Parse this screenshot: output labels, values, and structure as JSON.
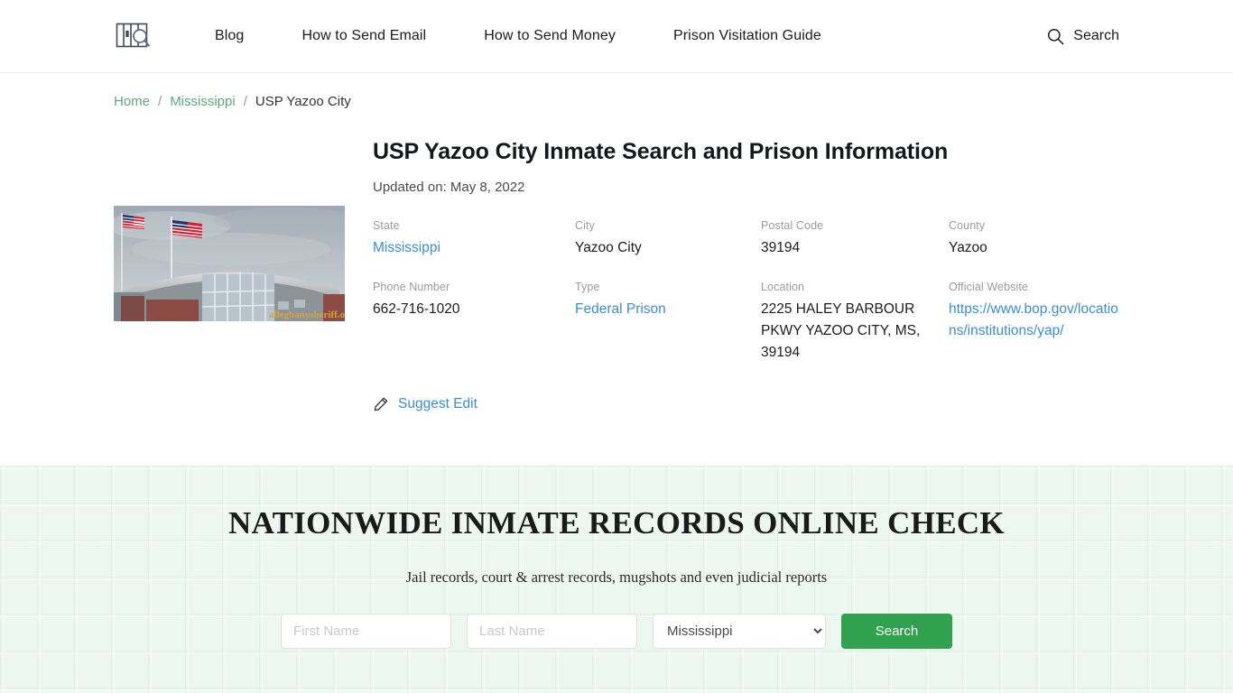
{
  "header": {
    "logo_icon": "prison-bars-search-logo",
    "nav": [
      {
        "label": "Blog"
      },
      {
        "label": "How to Send Email"
      },
      {
        "label": "How to Send Money"
      },
      {
        "label": "Prison Visitation Guide"
      }
    ],
    "search": {
      "label": "Search",
      "icon": "search-icon"
    }
  },
  "breadcrumb": {
    "home": "Home",
    "state": "Mississippi",
    "current": "USP Yazoo City",
    "separator": "/"
  },
  "main": {
    "title": "USP Yazoo City Inmate Search and Prison Information",
    "updated": "Updated on: May 8, 2022",
    "photo_alt": "USP Yazoo City prison building with American flags",
    "photo_watermark": "alleghanysheriff.org",
    "fields": [
      {
        "label": "State",
        "value": "Mississippi",
        "link": true
      },
      {
        "label": "City",
        "value": "Yazoo City",
        "link": false
      },
      {
        "label": "Postal Code",
        "value": "39194",
        "link": false
      },
      {
        "label": "County",
        "value": "Yazoo",
        "link": false
      },
      {
        "label": "Phone Number",
        "value": "662-716-1020",
        "link": false
      },
      {
        "label": "Type",
        "value": "Federal Prison",
        "link": true
      },
      {
        "label": "Location",
        "value": "2225 HALEY BARBOUR PKWY YAZOO CITY, MS, 39194",
        "link": false
      },
      {
        "label": "Official Website",
        "value": "https://www.bop.gov/locations/institutions/yap/",
        "link": true
      }
    ],
    "suggest_edit": {
      "label": "Suggest Edit",
      "icon": "pencil-icon"
    }
  },
  "cta": {
    "title": "NATIONWIDE INMATE RECORDS ONLINE CHECK",
    "subtitle": "Jail records, court & arrest records, mugshots and even judicial reports",
    "first_name_placeholder": "First Name",
    "first_name_value": "",
    "last_name_placeholder": "Last Name",
    "last_name_value": "",
    "state_selected": "Mississippi",
    "state_options": [
      "Mississippi"
    ],
    "search_button": "Search"
  },
  "colors": {
    "accent_green": "#30a14f",
    "link_blue": "#3b8dd0",
    "crumb_green": "#5ea87d",
    "cta_background": "#ecf7f0",
    "label_gray": "#9b9b9b"
  }
}
